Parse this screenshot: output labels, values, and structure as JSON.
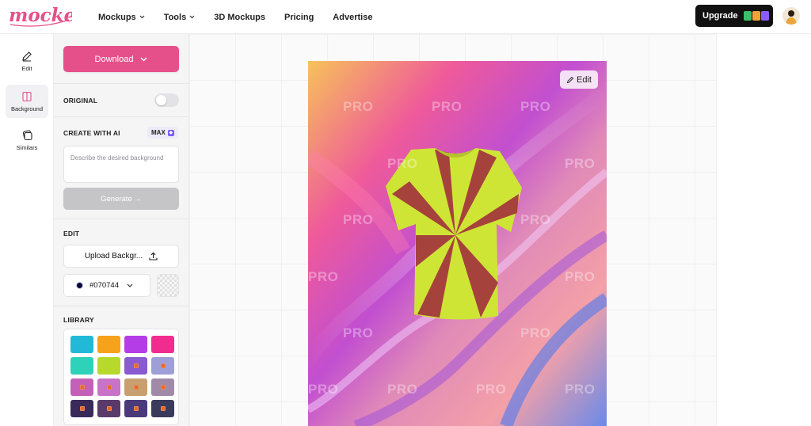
{
  "brand": {
    "logo_text": "mockey"
  },
  "nav": {
    "items": [
      {
        "label": "Mockups",
        "dropdown": true
      },
      {
        "label": "Tools",
        "dropdown": true
      },
      {
        "label": "3D Mockups",
        "dropdown": false
      },
      {
        "label": "Pricing",
        "dropdown": false
      },
      {
        "label": "Advertise",
        "dropdown": false
      }
    ],
    "upgrade_label": "Upgrade"
  },
  "rail": {
    "items": [
      {
        "label": "Edit",
        "icon": "pencil-icon"
      },
      {
        "label": "Background",
        "icon": "background-icon",
        "active": true
      },
      {
        "label": "Similars",
        "icon": "similars-icon"
      }
    ]
  },
  "panel": {
    "download_label": "Download",
    "original_label": "ORIGINAL",
    "original_toggle": false,
    "ai": {
      "label": "CREATE WITH AI",
      "badge": "MAX",
      "placeholder": "Describe the desired background",
      "generate_label": "Generate →"
    },
    "edit": {
      "label": "EDIT",
      "upload_label": "Upload Backgr...",
      "color_value": "#070744"
    },
    "library": {
      "label": "LIBRARY",
      "swatches": [
        "#22b8d8",
        "#f7a21b",
        "#b43de8",
        "#f02d8e",
        "#2ed2b8",
        "#b6d92c",
        "#8a5ad0",
        "#9f9fd8",
        "#c460b8",
        "#c873c8",
        "#c8a070",
        "#a08aa8",
        "#3a2a5a",
        "#5a3a6a",
        "#4a3a7a",
        "#3a3a5a"
      ]
    }
  },
  "canvas": {
    "edit_label": "Edit",
    "watermark": "PRO"
  },
  "colors": {
    "accent": "#e6508a",
    "dark": "#111111"
  }
}
